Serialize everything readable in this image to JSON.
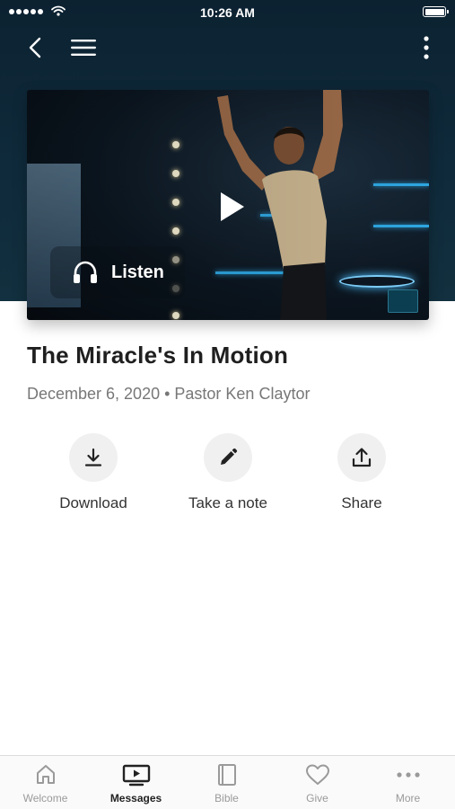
{
  "status_bar": {
    "time": "10:26 AM"
  },
  "message": {
    "title": "The Miracle's In Motion",
    "meta": "December 6, 2020 • Pastor Ken Claytor"
  },
  "video": {
    "listen_label": "Listen"
  },
  "actions": [
    {
      "label": "Download",
      "icon": "download-icon"
    },
    {
      "label": "Take a note",
      "icon": "pencil-icon"
    },
    {
      "label": "Share",
      "icon": "share-icon"
    }
  ],
  "tabs": [
    {
      "label": "Welcome",
      "icon": "home-icon",
      "active": false
    },
    {
      "label": "Messages",
      "icon": "play-screen-icon",
      "active": true
    },
    {
      "label": "Bible",
      "icon": "book-icon",
      "active": false
    },
    {
      "label": "Give",
      "icon": "heart-icon",
      "active": false
    },
    {
      "label": "More",
      "icon": "more-dots-icon",
      "active": false
    }
  ],
  "colors": {
    "header_bg": "#0f2a3b",
    "accent_blue": "#2ea6e0",
    "text_primary": "#1f1f1f",
    "text_secondary": "#777777",
    "tab_inactive": "#9a9a9a",
    "tab_active": "#222222"
  }
}
